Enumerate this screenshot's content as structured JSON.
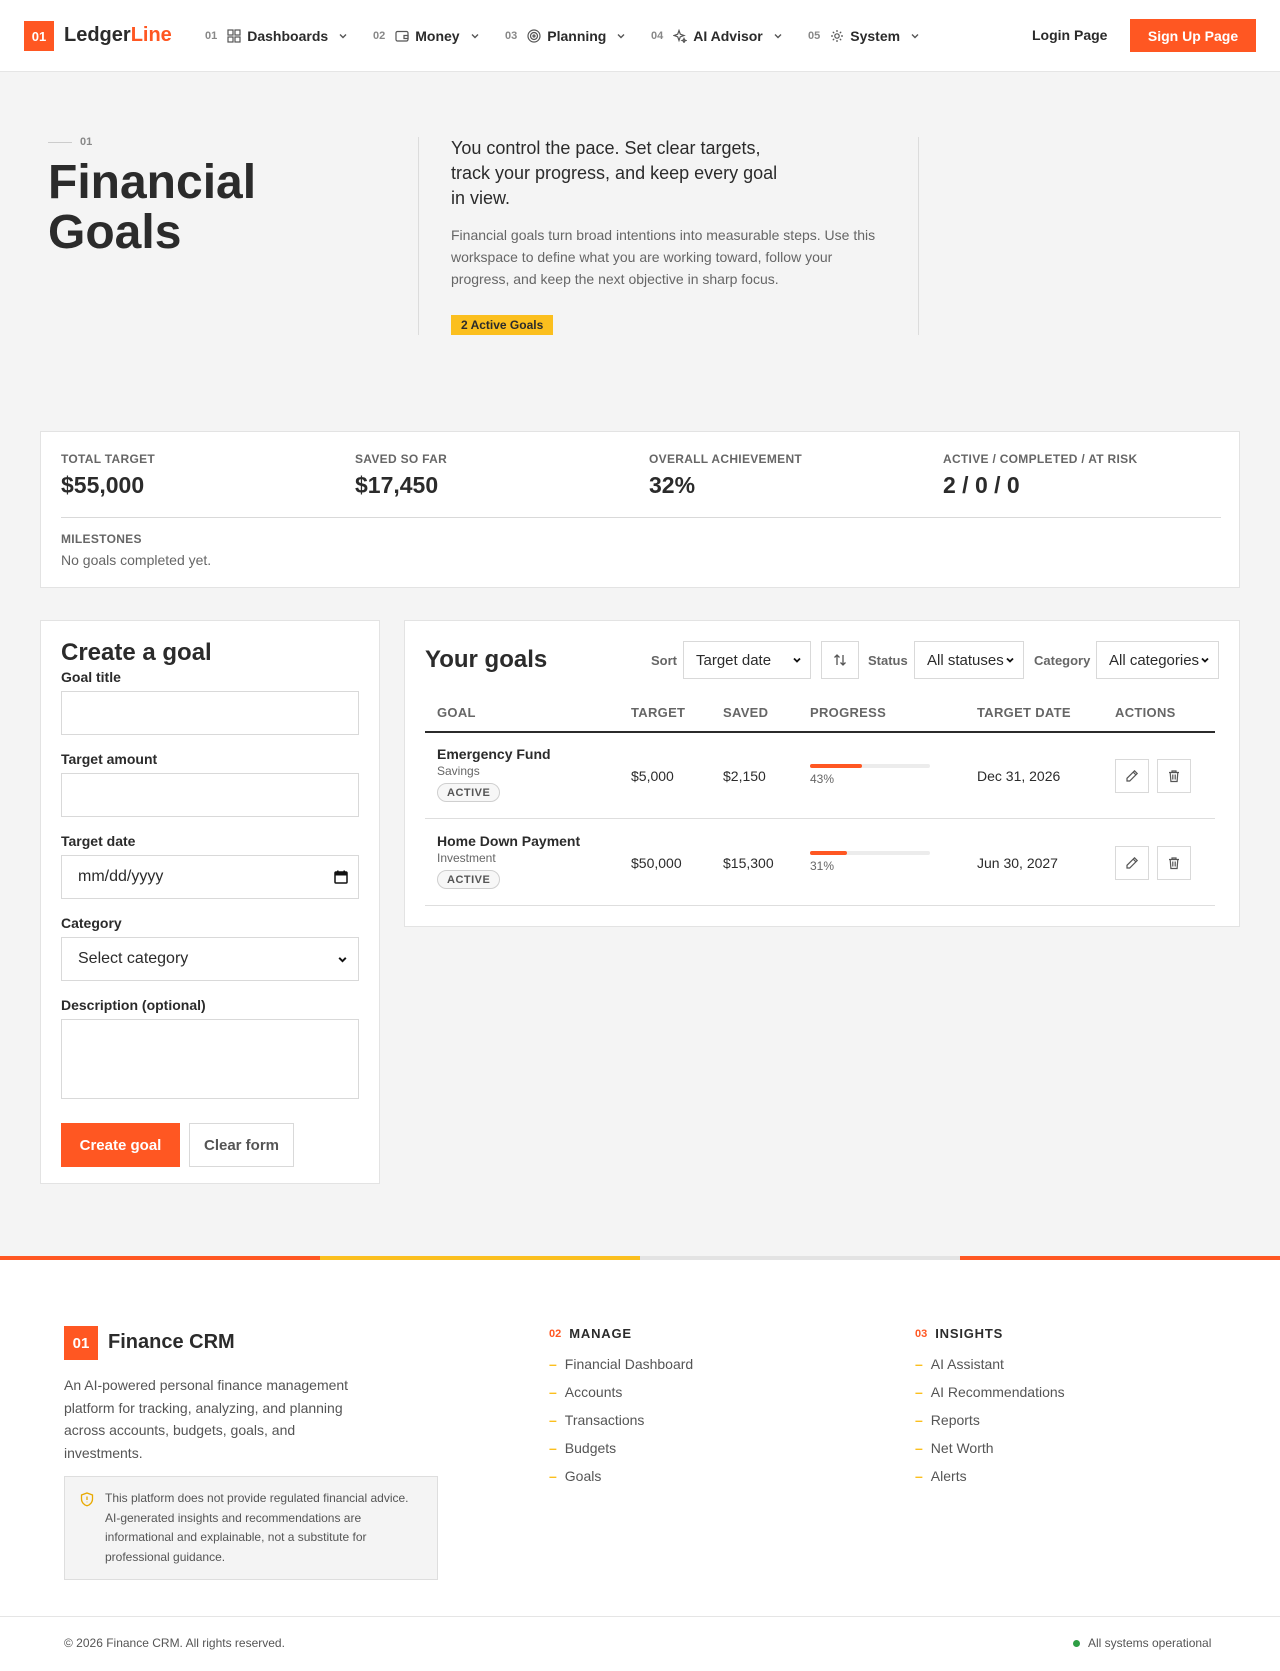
{
  "header": {
    "logo_num": "01",
    "logo_primary": "Ledger",
    "logo_accent": "Line",
    "nav": [
      {
        "num": "01",
        "label": "Dashboards",
        "icon": "grid-icon"
      },
      {
        "num": "02",
        "label": "Money",
        "icon": "wallet-icon"
      },
      {
        "num": "03",
        "label": "Planning",
        "icon": "target-icon"
      },
      {
        "num": "04",
        "label": "AI Advisor",
        "icon": "sparkle-icon"
      },
      {
        "num": "05",
        "label": "System",
        "icon": "gear-icon"
      }
    ],
    "login_label": "Login Page",
    "signup_label": "Sign Up Page"
  },
  "hero": {
    "num": "01",
    "title": "Financial Goals",
    "lead": "You control the pace. Set clear targets, track your progress, and keep every goal in view.",
    "description": "Financial goals turn broad intentions into measurable steps. Use this workspace to define what you are working toward, follow your progress, and keep the next objective in sharp focus.",
    "badge": "2 Active Goals"
  },
  "summary": {
    "total_target_label": "TOTAL TARGET",
    "total_target_value": "$55,000",
    "saved_label": "SAVED SO FAR",
    "saved_value": "$17,450",
    "achievement_label": "OVERALL ACHIEVEMENT",
    "achievement_value": "32%",
    "counts_label": "ACTIVE / COMPLETED / AT RISK",
    "counts_value": "2 / 0 / 0",
    "milestones_label": "MILESTONES",
    "milestones_text": "No goals completed yet."
  },
  "form": {
    "title": "Create a goal",
    "goal_title_label": "Goal title",
    "goal_title_value": "",
    "target_amount_label": "Target amount",
    "target_amount_value": "",
    "target_date_label": "Target date",
    "target_date_placeholder": "mm/dd/yyyy",
    "category_label": "Category",
    "category_value": "Select category",
    "description_label": "Description (optional)",
    "description_value": "",
    "create_label": "Create goal",
    "clear_label": "Clear form"
  },
  "goals": {
    "title": "Your goals",
    "sort_label": "Sort",
    "sort_value": "Target date",
    "status_label": "Status",
    "status_value": "All statuses",
    "category_label": "Category",
    "category_value": "All categories",
    "columns": [
      "GOAL",
      "TARGET",
      "SAVED",
      "PROGRESS",
      "TARGET DATE",
      "ACTIONS"
    ],
    "rows": [
      {
        "name": "Emergency Fund",
        "category": "Savings",
        "status": "ACTIVE",
        "target": "$5,000",
        "saved": "$2,150",
        "progress": 0.43,
        "progress_label": "43%",
        "date": "Dec 31, 2026"
      },
      {
        "name": "Home Down Payment",
        "category": "Investment",
        "status": "ACTIVE",
        "target": "$50,000",
        "saved": "$15,300",
        "progress": 0.31,
        "progress_label": "31%",
        "date": "Jun 30, 2027"
      }
    ]
  },
  "footer": {
    "logo_num": "01",
    "brand": "Finance CRM",
    "description": "An AI-powered personal finance management platform for tracking, analyzing, and planning across accounts, budgets, goals, and investments.",
    "disclaimer": "This platform does not provide regulated financial advice. AI-generated insights and recommendations are informational and explainable, not a substitute for professional guidance.",
    "manage": {
      "num": "02",
      "title": "MANAGE",
      "links": [
        "Financial Dashboard",
        "Accounts",
        "Transactions",
        "Budgets",
        "Goals"
      ]
    },
    "insights": {
      "num": "03",
      "title": "INSIGHTS",
      "links": [
        "AI Assistant",
        "AI Recommendations",
        "Reports",
        "Net Worth",
        "Alerts"
      ]
    },
    "copyright": "© 2026 Finance CRM. All rights reserved.",
    "status": "All systems operational"
  },
  "colors": {
    "accent": "#ff5722",
    "highlight": "#fbbf1e",
    "status_ok": "#2e9e44"
  }
}
